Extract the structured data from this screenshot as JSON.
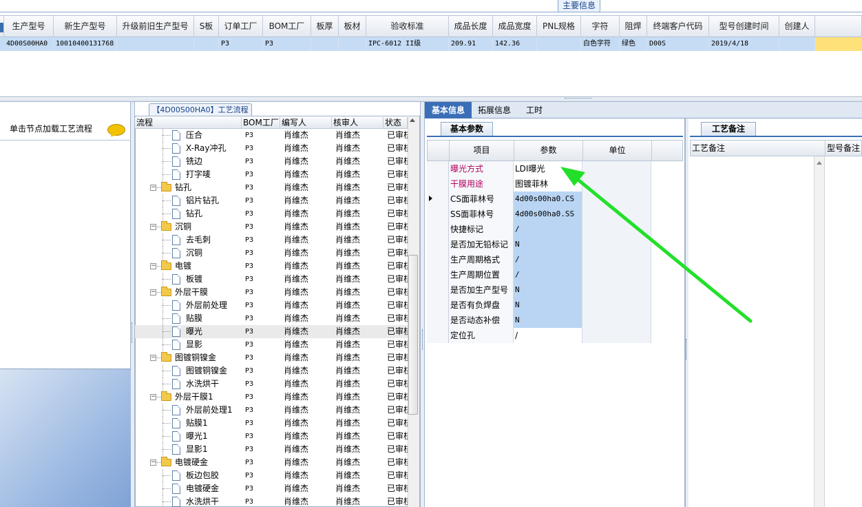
{
  "main_info_label": "主要信息",
  "grid": {
    "columns": [
      "生产型号",
      "新生产型号",
      "升级前旧生产型号",
      "S板",
      "订单工厂",
      "BOM工厂",
      "板厚",
      "板材",
      "验收标准",
      "成品长度",
      "成品宽度",
      "PNL规格",
      "字符",
      "阻焊",
      "终端客户代码",
      "型号创建时间",
      "创建人"
    ],
    "row": [
      "4D00S00HA0",
      "10010400131768",
      "",
      "",
      "P3",
      "P3",
      "",
      "",
      "IPC-6012 II级",
      "209.91",
      "142.36",
      "",
      "白色字符",
      "绿色",
      "D00S",
      "2019/4/18",
      ""
    ]
  },
  "left_panel": {
    "caption": "单击节点加载工艺流程"
  },
  "tree": {
    "title": "【4D00S00HA0】工艺流程",
    "headers": [
      "流程",
      "BOM工厂",
      "编写人",
      "核审人",
      "状态"
    ],
    "rows": [
      {
        "name": "压合",
        "type": "doc",
        "bom": "P3",
        "writer": "肖维杰",
        "reviewer": "肖维杰",
        "status": "已审核"
      },
      {
        "name": "X-Ray冲孔",
        "type": "doc",
        "bom": "P3",
        "writer": "肖维杰",
        "reviewer": "肖维杰",
        "status": "已审核"
      },
      {
        "name": "铣边",
        "type": "doc",
        "bom": "P3",
        "writer": "肖维杰",
        "reviewer": "肖维杰",
        "status": "已审核"
      },
      {
        "name": "打字唛",
        "type": "doc",
        "bom": "P3",
        "writer": "肖维杰",
        "reviewer": "肖维杰",
        "status": "已审核"
      },
      {
        "name": "钻孔",
        "type": "folder",
        "bom": "P3",
        "writer": "肖维杰",
        "reviewer": "肖维杰",
        "status": "已审核"
      },
      {
        "name": "铝片钻孔",
        "type": "doc",
        "bom": "P3",
        "writer": "肖维杰",
        "reviewer": "肖维杰",
        "status": "已审核"
      },
      {
        "name": "钻孔",
        "type": "doc",
        "bom": "P3",
        "writer": "肖维杰",
        "reviewer": "肖维杰",
        "status": "已审核"
      },
      {
        "name": "沉铜",
        "type": "folder",
        "bom": "P3",
        "writer": "肖维杰",
        "reviewer": "肖维杰",
        "status": "已审核"
      },
      {
        "name": "去毛刺",
        "type": "doc",
        "bom": "P3",
        "writer": "肖维杰",
        "reviewer": "肖维杰",
        "status": "已审核"
      },
      {
        "name": "沉铜",
        "type": "doc",
        "bom": "P3",
        "writer": "肖维杰",
        "reviewer": "肖维杰",
        "status": "已审核"
      },
      {
        "name": "电镀",
        "type": "folder",
        "bom": "P3",
        "writer": "肖维杰",
        "reviewer": "肖维杰",
        "status": "已审核"
      },
      {
        "name": "板镀",
        "type": "doc",
        "bom": "P3",
        "writer": "肖维杰",
        "reviewer": "肖维杰",
        "status": "已审核"
      },
      {
        "name": "外层干膜",
        "type": "folder",
        "bom": "P3",
        "writer": "肖维杰",
        "reviewer": "肖维杰",
        "status": "已审核"
      },
      {
        "name": "外层前处理",
        "type": "doc",
        "bom": "P3",
        "writer": "肖维杰",
        "reviewer": "肖维杰",
        "status": "已审核"
      },
      {
        "name": "贴膜",
        "type": "doc",
        "bom": "P3",
        "writer": "肖维杰",
        "reviewer": "肖维杰",
        "status": "已审核"
      },
      {
        "name": "曝光",
        "type": "doc",
        "bom": "P3",
        "writer": "肖维杰",
        "reviewer": "肖维杰",
        "status": "已审核",
        "selected": true
      },
      {
        "name": "显影",
        "type": "doc",
        "bom": "P3",
        "writer": "肖维杰",
        "reviewer": "肖维杰",
        "status": "已审核"
      },
      {
        "name": "图镀铜镍金",
        "type": "folder",
        "bom": "P3",
        "writer": "肖维杰",
        "reviewer": "肖维杰",
        "status": "已审核"
      },
      {
        "name": "图镀铜镍金",
        "type": "doc",
        "bom": "P3",
        "writer": "肖维杰",
        "reviewer": "肖维杰",
        "status": "已审核"
      },
      {
        "name": "水洗烘干",
        "type": "doc",
        "bom": "P3",
        "writer": "肖维杰",
        "reviewer": "肖维杰",
        "status": "已审核"
      },
      {
        "name": "外层干膜1",
        "type": "folder",
        "bom": "P3",
        "writer": "肖维杰",
        "reviewer": "肖维杰",
        "status": "已审核"
      },
      {
        "name": "外层前处理1",
        "type": "doc",
        "bom": "P3",
        "writer": "肖维杰",
        "reviewer": "肖维杰",
        "status": "已审核"
      },
      {
        "name": "贴膜1",
        "type": "doc",
        "bom": "P3",
        "writer": "肖维杰",
        "reviewer": "肖维杰",
        "status": "已审核"
      },
      {
        "name": "曝光1",
        "type": "doc",
        "bom": "P3",
        "writer": "肖维杰",
        "reviewer": "肖维杰",
        "status": "已审核"
      },
      {
        "name": "显影1",
        "type": "doc",
        "bom": "P3",
        "writer": "肖维杰",
        "reviewer": "肖维杰",
        "status": "已审核"
      },
      {
        "name": "电镀硬金",
        "type": "folder",
        "bom": "P3",
        "writer": "肖维杰",
        "reviewer": "肖维杰",
        "status": "已审核"
      },
      {
        "name": "板边包胶",
        "type": "doc",
        "bom": "P3",
        "writer": "肖维杰",
        "reviewer": "肖维杰",
        "status": "已审核"
      },
      {
        "name": "电镀硬金",
        "type": "doc",
        "bom": "P3",
        "writer": "肖维杰",
        "reviewer": "肖维杰",
        "status": "已审核"
      },
      {
        "name": "水洗烘干",
        "type": "doc",
        "bom": "P3",
        "writer": "肖维杰",
        "reviewer": "肖维杰",
        "status": "已审核"
      }
    ]
  },
  "right_tabs": [
    "基本信息",
    "拓展信息",
    "工时"
  ],
  "params": {
    "tab_label": "基本参数",
    "headers": [
      "项目",
      "参数",
      "单位"
    ],
    "rows": [
      {
        "item": "曝光方式",
        "value": "LDI曝光",
        "highlight": true,
        "value_white": true
      },
      {
        "item": "干膜用途",
        "value": "图镀菲林",
        "highlight": true,
        "value_white": true
      },
      {
        "item": "CS面菲林号",
        "value": "4d00s00ha0.CS",
        "current": true
      },
      {
        "item": "SS面菲林号",
        "value": "4d00s00ha0.SS"
      },
      {
        "item": "快捷标记",
        "value": "/"
      },
      {
        "item": "是否加无铅标记",
        "value": "N"
      },
      {
        "item": "生产周期格式",
        "value": "/"
      },
      {
        "item": "生产周期位置",
        "value": "/"
      },
      {
        "item": "是否加生产型号",
        "value": "N"
      },
      {
        "item": "是否有负焊盘",
        "value": "N"
      },
      {
        "item": "是否动态补偿",
        "value": "N"
      },
      {
        "item": "定位孔",
        "value": "/",
        "value_white": true
      }
    ]
  },
  "notes": {
    "tab_label": "工艺备注",
    "headers": [
      "工艺备注",
      "型号备注"
    ]
  },
  "colors": {
    "accent": "#3a6fb7",
    "selection": "#c6dcf5",
    "annotation_arrow": "#22e02a"
  }
}
